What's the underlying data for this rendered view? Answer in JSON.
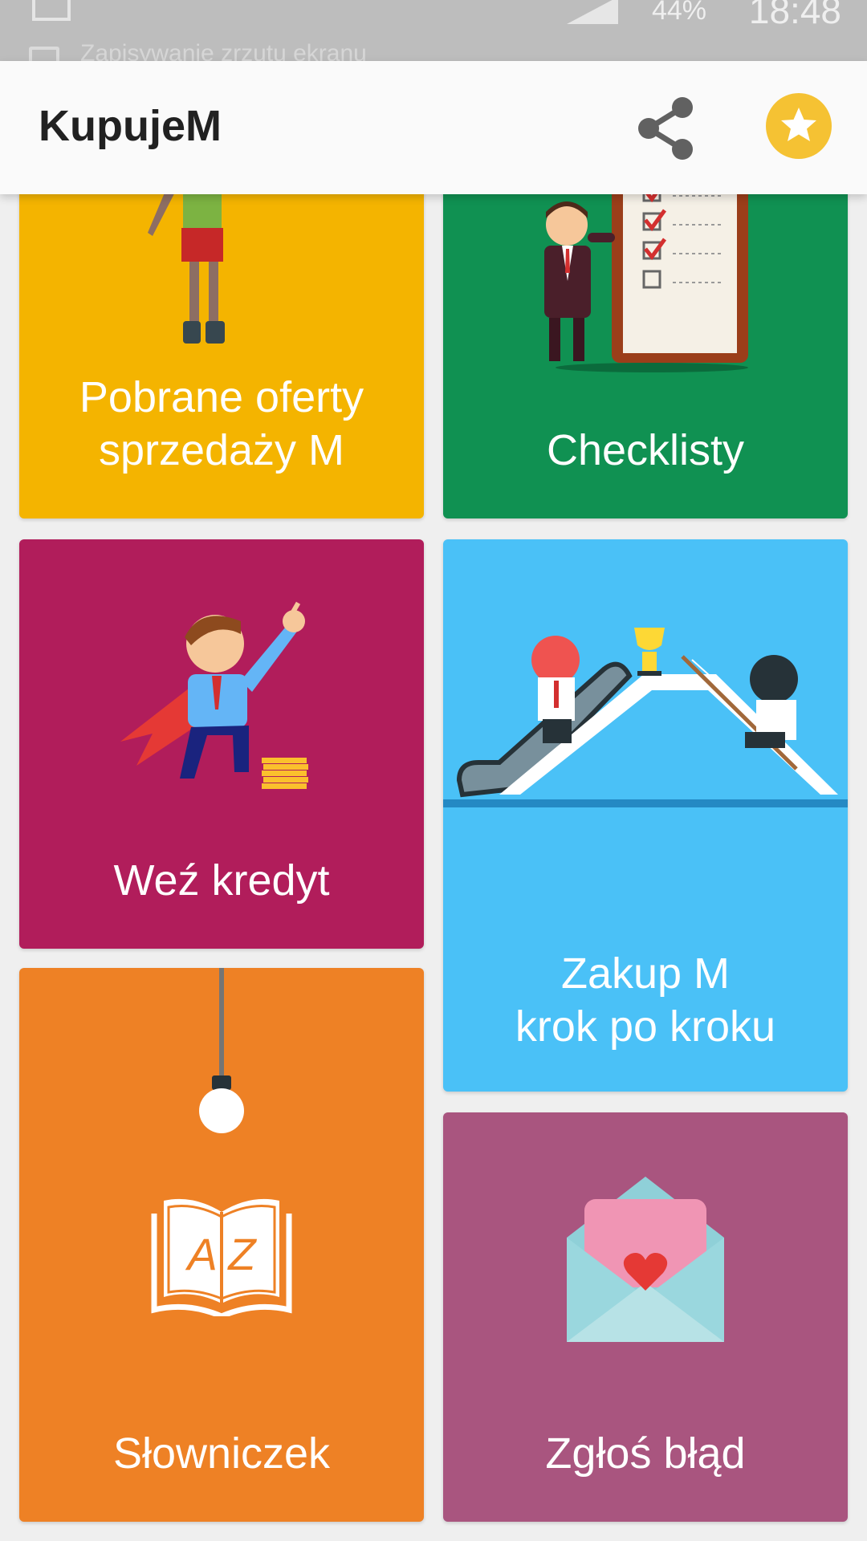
{
  "status_bar": {
    "time": "18:48",
    "battery": "44%",
    "notification": "Zapisywanie zrzutu ekranu"
  },
  "app_bar": {
    "title": "KupujeM",
    "icons": {
      "share": "share-icon",
      "favorite": "star-icon"
    }
  },
  "tiles": [
    {
      "id": "offers",
      "label_line1": "Pobrane oferty",
      "label_line2": "sprzedaży M",
      "color": "#f4b400"
    },
    {
      "id": "checklists",
      "label": "Checklisty",
      "color": "#109152"
    },
    {
      "id": "loan",
      "label": "Weź kredyt",
      "color": "#b11d5b"
    },
    {
      "id": "purchase",
      "label_line1": "Zakup M",
      "label_line2": "krok po kroku",
      "color": "#4ac1f7"
    },
    {
      "id": "glossary",
      "label": "Słowniczek",
      "color": "#ee8125",
      "book_letters": "A Z"
    },
    {
      "id": "report",
      "label": "Zgłoś błąd",
      "color": "#a9557f"
    }
  ]
}
